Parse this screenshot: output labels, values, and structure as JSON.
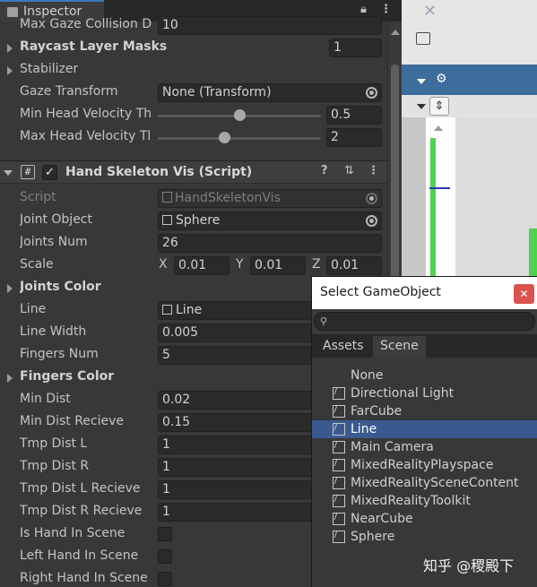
{
  "inspector": {
    "tab_label": "Inspector",
    "lock_icon": "lock-icon",
    "menu_icon": "kebab-menu-icon"
  },
  "rows_top": {
    "max_gaze": {
      "label": "Max Gaze Collision D",
      "value": "10"
    },
    "raycast": {
      "label": "Raycast Layer Masks",
      "value": "1"
    },
    "stabilizer": {
      "label": "Stabilizer"
    },
    "gaze_transform": {
      "label": "Gaze Transform",
      "value": "None (Transform)"
    },
    "min_head": {
      "label": "Min Head Velocity Th",
      "value": "0.5",
      "slider_fraction": 0.5
    },
    "max_head": {
      "label": "Max Head Velocity Tl",
      "value": "2",
      "slider_fraction": 0.4
    }
  },
  "component": {
    "title": "Hand Skeleton Vis (Script)",
    "enabled": "✓",
    "script": {
      "label": "Script",
      "value": "HandSkeletonVis"
    },
    "joint_object": {
      "label": "Joint Object",
      "value": "Sphere"
    },
    "joints_num": {
      "label": "Joints Num",
      "value": "26"
    },
    "scale": {
      "label": "Scale",
      "x_label": "X",
      "x": "0.01",
      "y_label": "Y",
      "y": "0.01",
      "z_label": "Z",
      "z": "0.01"
    },
    "joints_color": {
      "label": "Joints Color"
    },
    "line": {
      "label": "Line",
      "value": "Line"
    },
    "line_width": {
      "label": "Line Width",
      "value": "0.005"
    },
    "fingers_num": {
      "label": "Fingers Num",
      "value": "5"
    },
    "fingers_color": {
      "label": "Fingers Color"
    },
    "min_dist": {
      "label": "Min Dist",
      "value": "0.02"
    },
    "min_dist_recieve": {
      "label": "Min Dist Recieve",
      "value": "0.15"
    },
    "tmp_dist_l": {
      "label": "Tmp Dist L",
      "value": "1"
    },
    "tmp_dist_r": {
      "label": "Tmp Dist R",
      "value": "1"
    },
    "tmp_dist_l_recieve": {
      "label": "Tmp Dist L Recieve",
      "value": "1"
    },
    "tmp_dist_r_recieve": {
      "label": "Tmp Dist R Recieve",
      "value": "1"
    },
    "is_hand": {
      "label": "Is Hand In Scene"
    },
    "left_hand": {
      "label": "Left Hand In Scene"
    },
    "right_hand": {
      "label": "Right Hand In Scene"
    }
  },
  "picker": {
    "title": "Select GameObject",
    "close": "✕",
    "search_icon": "⚲",
    "tabs": [
      "Assets",
      "Scene"
    ],
    "items": [
      {
        "label": "None",
        "has_icon": false,
        "selected": false
      },
      {
        "label": "Directional Light",
        "has_icon": true,
        "selected": false
      },
      {
        "label": "FarCube",
        "has_icon": true,
        "selected": false
      },
      {
        "label": "Line",
        "has_icon": true,
        "selected": true
      },
      {
        "label": "Main Camera",
        "has_icon": true,
        "selected": false
      },
      {
        "label": "MixedRealityPlayspace",
        "has_icon": true,
        "selected": false
      },
      {
        "label": "MixedRealitySceneContent",
        "has_icon": true,
        "selected": false
      },
      {
        "label": "MixedRealityToolkit",
        "has_icon": true,
        "selected": false
      },
      {
        "label": "NearCube",
        "has_icon": true,
        "selected": false
      },
      {
        "label": "Sphere",
        "has_icon": true,
        "selected": false
      }
    ]
  },
  "watermark": "知乎 @稷殿下",
  "colors": {
    "selection": "#3a5a8f",
    "scene_bar": "#3d6d9d",
    "close_button": "#d9534f"
  }
}
